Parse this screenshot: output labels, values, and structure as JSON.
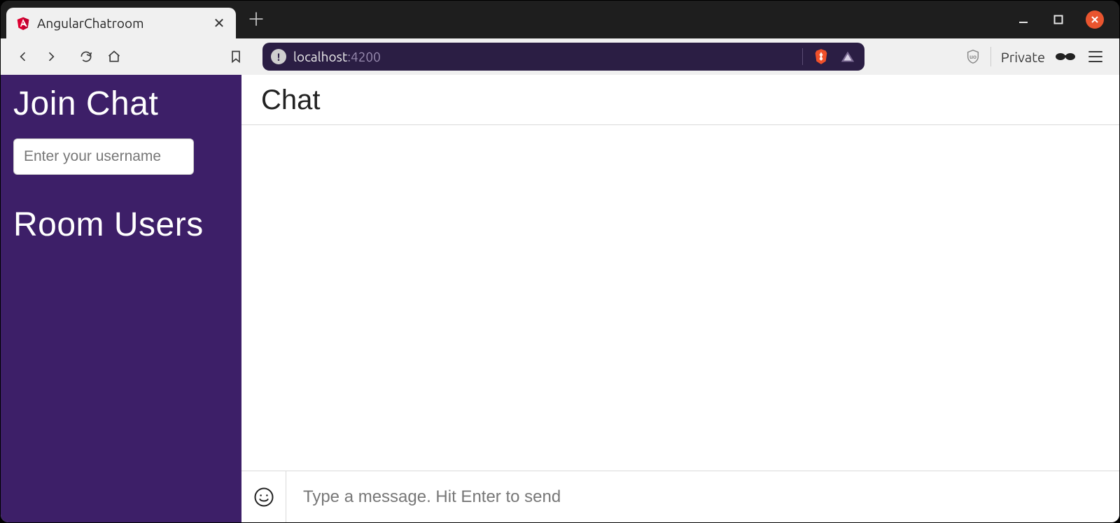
{
  "browser": {
    "tab": {
      "title": "AngularChatroom"
    },
    "address": {
      "info_symbol": "!",
      "host": "localhost",
      "port": ":4200"
    },
    "private_label": "Private"
  },
  "sidebar": {
    "join_heading": "Join Chat",
    "username_placeholder": "Enter your username",
    "room_users_heading": "Room Users"
  },
  "main": {
    "chat_heading": "Chat",
    "message_placeholder": "Type a message. Hit Enter to send"
  }
}
